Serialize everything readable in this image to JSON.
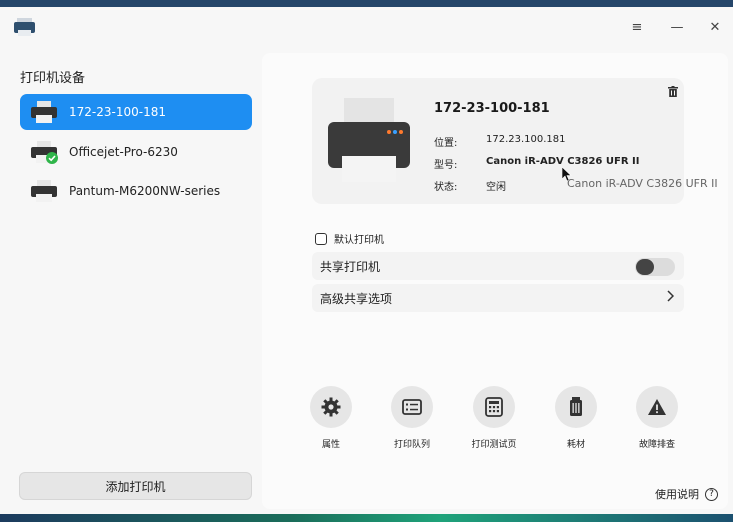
{
  "window": {
    "menu_icon": "≡",
    "minimize_icon": "—",
    "close_icon": "✕"
  },
  "sidebar": {
    "title": "打印机设备",
    "printers": [
      {
        "label": "172-23-100-181",
        "selected": true,
        "is_default": false
      },
      {
        "label": "Officejet-Pro-6230",
        "selected": false,
        "is_default": true
      },
      {
        "label": "Pantum-M6200NW-series",
        "selected": false,
        "is_default": false
      }
    ],
    "add_button": "添加打印机"
  },
  "detail": {
    "name": "172-23-100-181",
    "location_label": "位置:",
    "location_value": "172.23.100.181",
    "model_label": "型号:",
    "model_value": "Canon iR-ADV C3826 UFR II",
    "status_label": "状态:",
    "status_value": "空闲",
    "tooltip": "Canon iR-ADV C3826 UFR II"
  },
  "options": {
    "default_printer_label": "默认打印机",
    "default_printer_checked": false,
    "share_printer_label": "共享打印机",
    "share_printer_on": false,
    "advanced_share_label": "高级共享选项"
  },
  "actions": [
    {
      "label": "属性",
      "icon": "gear-icon"
    },
    {
      "label": "打印队列",
      "icon": "print-queue-icon"
    },
    {
      "label": "打印测试页",
      "icon": "test-page-icon"
    },
    {
      "label": "耗材",
      "icon": "supplies-icon"
    },
    {
      "label": "故障排查",
      "icon": "warning-icon"
    }
  ],
  "help": {
    "label": "使用说明",
    "icon_text": "?"
  },
  "colors": {
    "accent": "#1e8ef2",
    "default_badge": "#2fb54a"
  }
}
